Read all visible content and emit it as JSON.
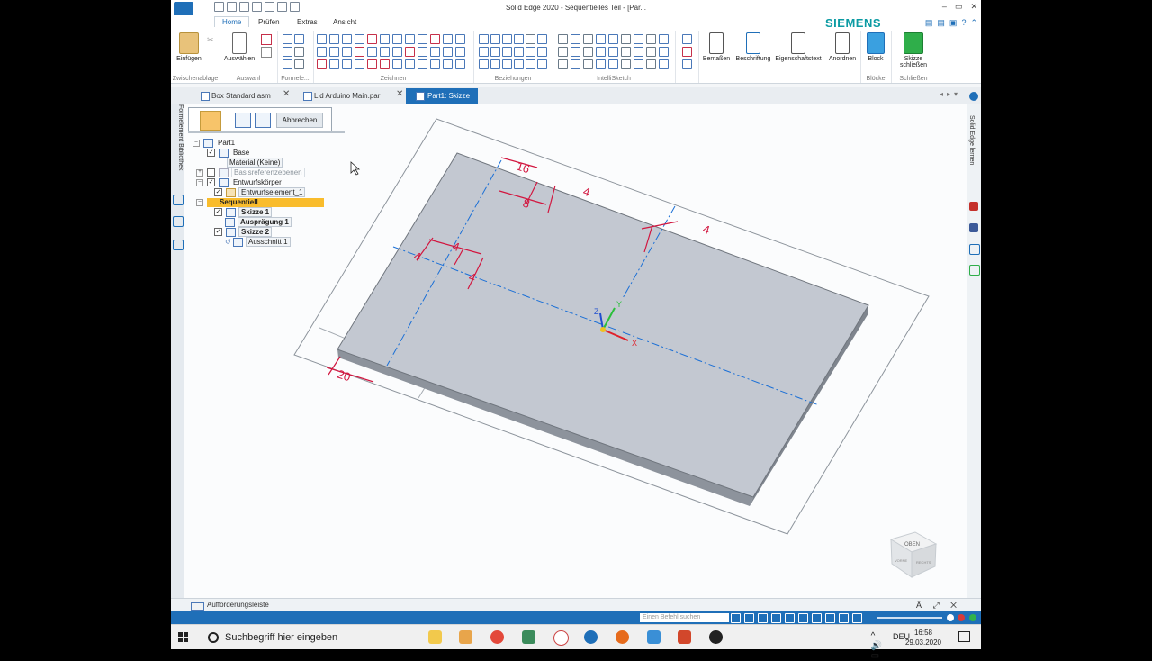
{
  "window": {
    "title": "Solid Edge 2020 - Sequentielles Teil - [Par...",
    "brand": "SIEMENS",
    "controls": [
      "–",
      "▭",
      "✕"
    ]
  },
  "ribbon": {
    "tabs": [
      "Home",
      "Prüfen",
      "Extras",
      "Ansicht"
    ],
    "active_tab": "Home",
    "buttons": {
      "einfuegen": "Einfügen",
      "auswaehlen": "Auswählen",
      "bemassen": "Bemaßen",
      "beschriftung": "Beschriftung",
      "eigenschaftstext": "Eigenschaftstext",
      "anordnen": "Anordnen",
      "block": "Block",
      "skizze_schliessen_line1": "Skizze",
      "skizze_schliessen_line2": "schließen"
    },
    "groups": {
      "zwischenablage": "Zwischenablage",
      "auswahl": "Auswahl",
      "formele": "Formele...",
      "zeichnen": "Zeichnen",
      "beziehungen": "Beziehungen",
      "intellisketch": "IntelliSketch",
      "bloecke": "Blöcke",
      "schliessen": "Schließen"
    }
  },
  "doc_tabs": [
    {
      "label": "Box Standard.asm",
      "active": false
    },
    {
      "label": "Lid Arduino Main.par",
      "active": false
    },
    {
      "label": "Part1: Skizze",
      "active": true
    }
  ],
  "sidebars": {
    "left": "Formelement Bibliothek",
    "right": "Solid Edge lernen"
  },
  "command_bar": {
    "cancel": "Abbrechen"
  },
  "tree": {
    "part1": "Part1",
    "base": "Base",
    "material": "Material (Keine)",
    "basisreferenzebenen": "Basisreferenzebenen",
    "entwurfskoerper": "Entwurfskörper",
    "entwurfselement": "Entwurfselement_1",
    "sequentiell": "Sequentiell",
    "skizze1": "Skizze 1",
    "auspraegung1": "Ausprägung 1",
    "skizze2": "Skizze 2",
    "ausschnitt1": "Ausschnitt 1"
  },
  "dimensions": {
    "d16": "16",
    "d8": "8",
    "d4_top": "4",
    "d4_right": "4",
    "d4_left_h": "4",
    "d4_left_v1": "4",
    "d4_left_v2": "4",
    "d20": "20"
  },
  "axes": {
    "x": "X",
    "y": "Y",
    "z": "Z"
  },
  "viewcube": {
    "top": "OBEN",
    "front": "VORNE",
    "side": "RECHTS"
  },
  "prompt_bar": {
    "label": "Aufforderungsleiste",
    "right_icons": "Ä ⤢ ✕"
  },
  "status_bar": {
    "search_placeholder": "Einen Befehl suchen"
  },
  "taskbar": {
    "search_placeholder": "Suchbegriff hier eingeben",
    "language": "DEU",
    "time": "16:58",
    "date": "29.03.2020",
    "tray_arrows": "^ 🔊 ▭"
  },
  "colors": {
    "accent": "#1f6fb8",
    "plate": "#c3c8d1",
    "dimension": "#d2163f",
    "centerline": "#1a6fd6",
    "tree_highlight": "#f9bc2c"
  }
}
